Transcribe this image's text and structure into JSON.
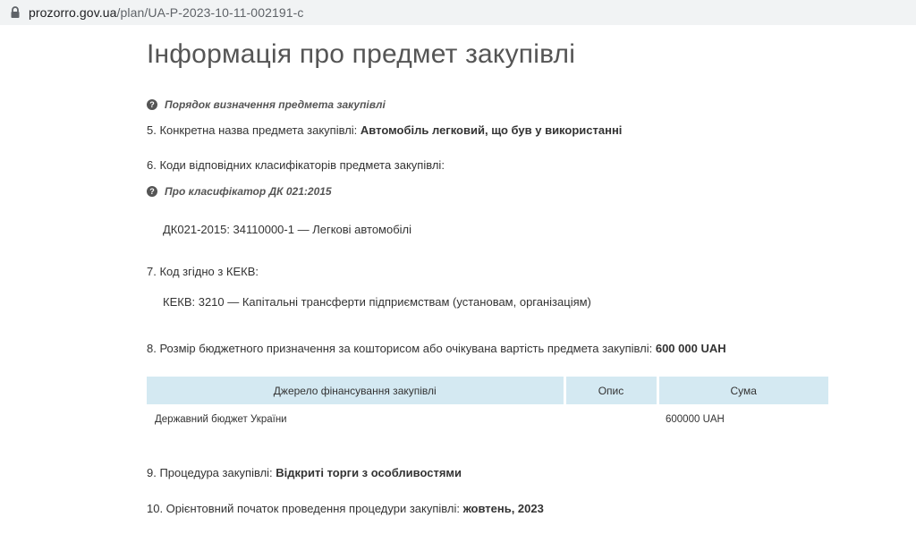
{
  "browser": {
    "url_host": "prozorro.gov.ua",
    "url_path": "/plan/UA-P-2023-10-11-002191-c"
  },
  "page": {
    "title": "Інформація про предмет закупівлі"
  },
  "help_links": {
    "subject_order": "Порядок визначення предмета закупівлі",
    "classifier": "Про класифікатор ДК 021:2015"
  },
  "items": {
    "item5_label": "5. Конкретна назва предмета закупівлі:",
    "item5_value": "Автомобіль легковий, що був у використанні",
    "item6_label": "6. Коди відповідних класифікаторів предмета закупівлі:",
    "item6_code": "ДК021-2015: 34110000-1 — Легкові автомобілі",
    "item7_label": "7. Код згідно з КЕКВ:",
    "item7_code": "КЕКВ: 3210 — Капітальні трансферти підприємствам (установам, організаціям)",
    "item8_label": "8. Розмір бюджетного призначення за кошторисом або очікувана вартість предмета закупівлі:",
    "item8_value": "600 000 UAH",
    "item9_label": "9. Процедура закупівлі:",
    "item9_value": "Відкриті торги з особливостями",
    "item10_label": "10. Орієнтовний початок проведення процедури закупівлі:",
    "item10_value": "жовтень, 2023"
  },
  "funding_table": {
    "headers": [
      "Джерело фінансування закупівлі",
      "Опис",
      "Сума"
    ],
    "rows": [
      [
        "Державний бюджет України",
        "",
        "600000 UAH"
      ]
    ]
  }
}
